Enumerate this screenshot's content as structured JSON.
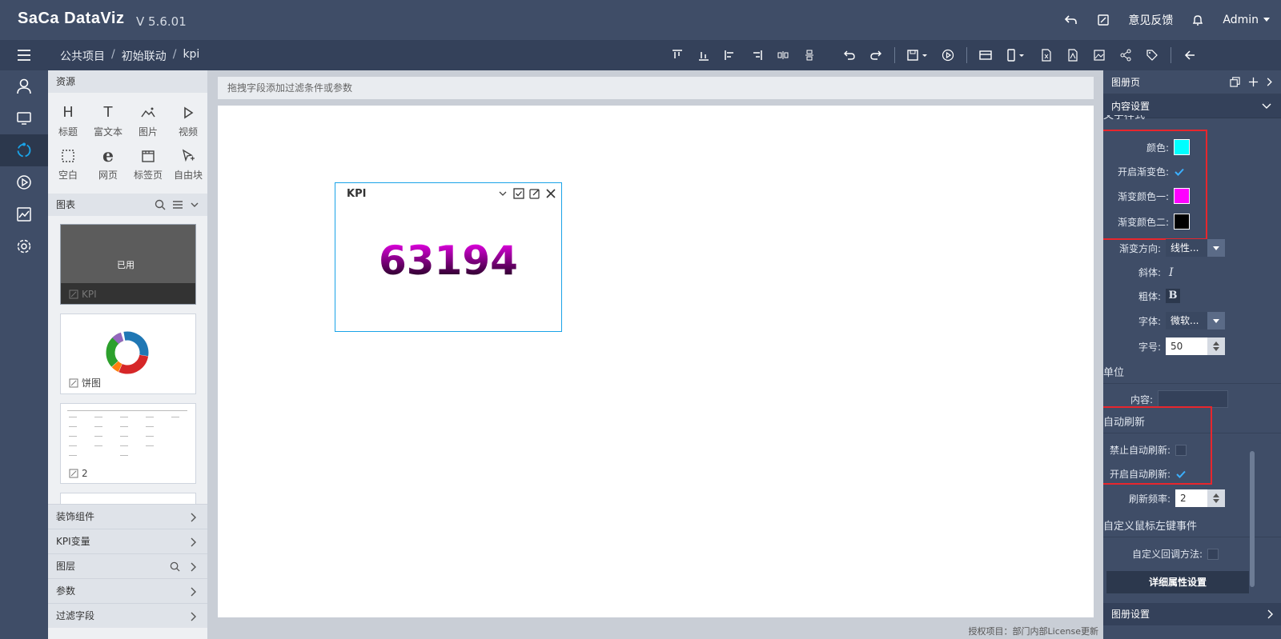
{
  "app": {
    "logo": "SaCa DataViz",
    "version": "V 5.6.01"
  },
  "topbar": {
    "feedback": "意见反馈",
    "user": "Admin"
  },
  "breadcrumb": [
    "公共项目",
    "初始联动",
    "kpi"
  ],
  "resources": {
    "header": "资源",
    "items": [
      {
        "label": "标题",
        "icon": "H"
      },
      {
        "label": "富文本",
        "icon": "T"
      },
      {
        "label": "图片",
        "icon": "image-icon"
      },
      {
        "label": "视频",
        "icon": "play-icon"
      },
      {
        "label": "空白",
        "icon": "blank-icon"
      },
      {
        "label": "网页",
        "icon": "e"
      },
      {
        "label": "标签页",
        "icon": "tab-icon"
      },
      {
        "label": "自由块",
        "icon": "pointer-icon"
      }
    ]
  },
  "charts": {
    "header": "图表",
    "items": [
      {
        "label": "KPI",
        "status": "已用"
      },
      {
        "label": "饼图"
      },
      {
        "label": "2"
      }
    ]
  },
  "accordion": [
    "装饰组件",
    "KPI变量",
    "图层",
    "参数",
    "过滤字段"
  ],
  "canvas": {
    "filter_hint": "拖拽字段添加过滤条件或参数",
    "kpi": {
      "title": "KPI",
      "value": "63194"
    },
    "license": "授权项目：部门内部License更新"
  },
  "right_panel": {
    "title": "图册页",
    "content_settings": "内容设置",
    "text_style_partial": "文字样式",
    "color_label": "颜色:",
    "color_value": "#00ffff",
    "gradient_enable_label": "开启渐变色:",
    "gradient_enabled": true,
    "gradient1_label": "渐变颜色一:",
    "gradient1_value": "#ff00ff",
    "gradient2_label": "渐变颜色二:",
    "gradient2_value": "#000000",
    "direction_label": "渐变方向:",
    "direction_value": "线性...",
    "italic_label": "斜体:",
    "bold_label": "粗体:",
    "font_label": "字体:",
    "font_value": "微软...",
    "size_label": "字号:",
    "size_value": "50",
    "unit_section": "单位",
    "content_label": "内容:",
    "content_value": "",
    "refresh_section": "自动刷新",
    "disable_refresh_label": "禁止自动刷新:",
    "disable_refresh": false,
    "enable_refresh_label": "开启自动刷新:",
    "enable_refresh": true,
    "refresh_rate_label": "刷新频率:",
    "refresh_rate_value": "2",
    "mouse_event_section": "自定义鼠标左键事件",
    "callback_label": "自定义回调方法:",
    "detail_button": "详细属性设置",
    "footer": "图册设置"
  },
  "colors": {
    "accent": "#1aa3e8",
    "header_bg": "#3f4d67",
    "highlight": "#e8262d"
  }
}
